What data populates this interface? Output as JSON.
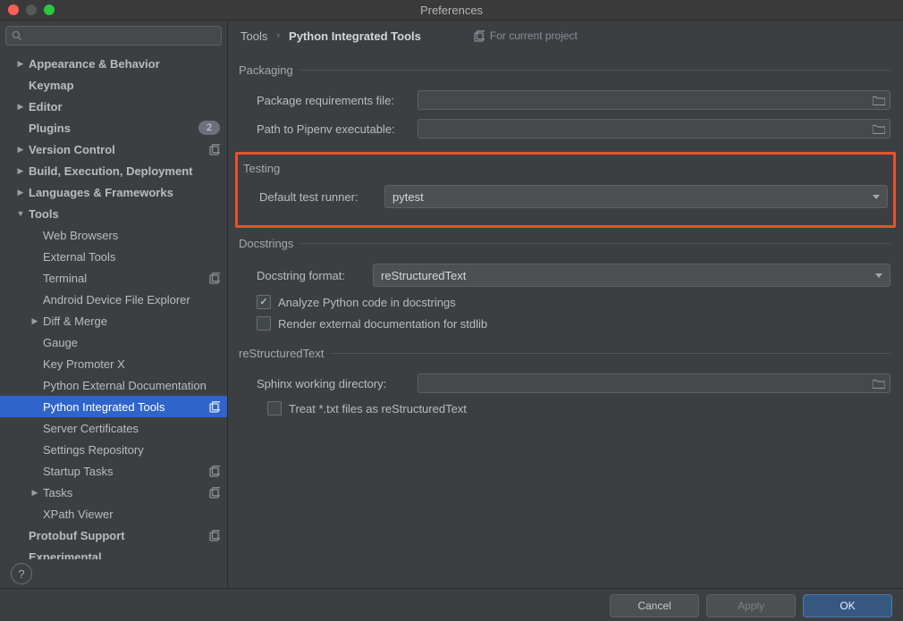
{
  "window": {
    "title": "Preferences"
  },
  "search": {
    "placeholder": ""
  },
  "sidebar": {
    "items": [
      {
        "label": "Appearance & Behavior",
        "indent": 0,
        "arrow": "right",
        "bold": true
      },
      {
        "label": "Keymap",
        "indent": 0,
        "arrow": "",
        "bold": true
      },
      {
        "label": "Editor",
        "indent": 0,
        "arrow": "right",
        "bold": true
      },
      {
        "label": "Plugins",
        "indent": 0,
        "arrow": "",
        "bold": true,
        "badge": "2"
      },
      {
        "label": "Version Control",
        "indent": 0,
        "arrow": "right",
        "bold": true,
        "proj": true
      },
      {
        "label": "Build, Execution, Deployment",
        "indent": 0,
        "arrow": "right",
        "bold": true
      },
      {
        "label": "Languages & Frameworks",
        "indent": 0,
        "arrow": "right",
        "bold": true
      },
      {
        "label": "Tools",
        "indent": 0,
        "arrow": "down",
        "bold": true
      },
      {
        "label": "Web Browsers",
        "indent": 1,
        "arrow": ""
      },
      {
        "label": "External Tools",
        "indent": 1,
        "arrow": ""
      },
      {
        "label": "Terminal",
        "indent": 1,
        "arrow": "",
        "proj": true
      },
      {
        "label": "Android Device File Explorer",
        "indent": 1,
        "arrow": ""
      },
      {
        "label": "Diff & Merge",
        "indent": 1,
        "arrow": "right"
      },
      {
        "label": "Gauge",
        "indent": 1,
        "arrow": ""
      },
      {
        "label": "Key Promoter X",
        "indent": 1,
        "arrow": ""
      },
      {
        "label": "Python External Documentation",
        "indent": 1,
        "arrow": ""
      },
      {
        "label": "Python Integrated Tools",
        "indent": 1,
        "arrow": "",
        "proj": true,
        "selected": true
      },
      {
        "label": "Server Certificates",
        "indent": 1,
        "arrow": ""
      },
      {
        "label": "Settings Repository",
        "indent": 1,
        "arrow": ""
      },
      {
        "label": "Startup Tasks",
        "indent": 1,
        "arrow": "",
        "proj": true
      },
      {
        "label": "Tasks",
        "indent": 1,
        "arrow": "right",
        "proj": true
      },
      {
        "label": "XPath Viewer",
        "indent": 1,
        "arrow": ""
      },
      {
        "label": "Protobuf Support",
        "indent": 0,
        "arrow": "",
        "bold": true,
        "proj": true
      },
      {
        "label": "Experimental",
        "indent": 0,
        "arrow": "",
        "bold": true
      }
    ]
  },
  "breadcrumb": {
    "root": "Tools",
    "sep": "›",
    "current": "Python Integrated Tools"
  },
  "for_project_label": "For current project",
  "groups": {
    "packaging": {
      "legend": "Packaging",
      "req_label": "Package requirements file:",
      "req_value": "",
      "pipenv_label": "Path to Pipenv executable:",
      "pipenv_value": ""
    },
    "testing": {
      "legend": "Testing",
      "runner_label": "Default test runner:",
      "runner_value": "pytest"
    },
    "docstrings": {
      "legend": "Docstrings",
      "format_label": "Docstring format:",
      "format_value": "reStructuredText",
      "analyze_label": "Analyze Python code in docstrings",
      "render_label": "Render external documentation for stdlib"
    },
    "rst": {
      "legend": "reStructuredText",
      "sphinx_label": "Sphinx working directory:",
      "sphinx_value": "",
      "treat_txt_label": "Treat *.txt files as reStructuredText"
    }
  },
  "footer": {
    "cancel": "Cancel",
    "apply": "Apply",
    "ok": "OK"
  },
  "help_glyph": "?"
}
